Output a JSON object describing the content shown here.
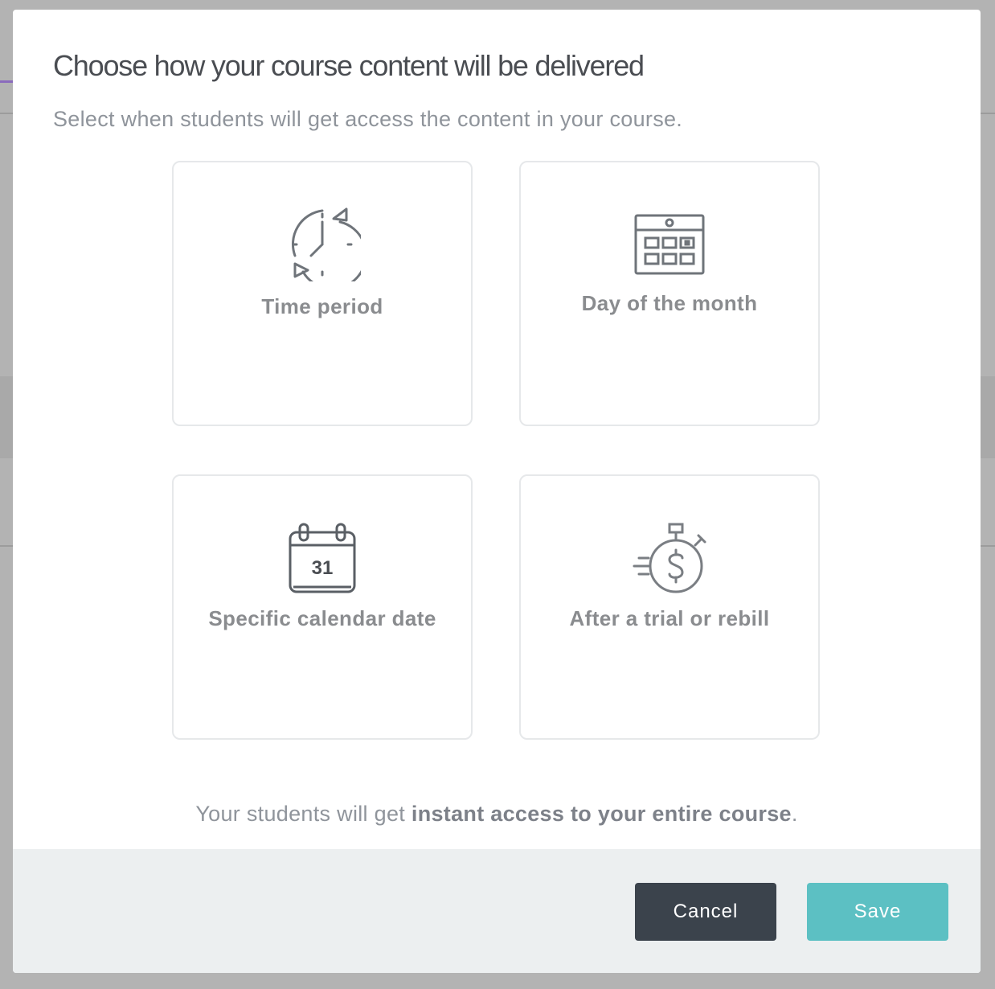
{
  "modal": {
    "title": "Choose how your course content will be delivered",
    "subtitle": "Select when students will get access the content in your course."
  },
  "options": [
    {
      "label": "Time period",
      "icon": "clock-cycle-icon"
    },
    {
      "label": "Day of the month",
      "icon": "calendar-grid-icon"
    },
    {
      "label": "Specific calendar date",
      "icon": "calendar-date-icon",
      "icon_text": "31"
    },
    {
      "label": "After a trial or rebill",
      "icon": "stopwatch-dollar-icon"
    }
  ],
  "info": {
    "prefix": "Your students will get ",
    "emphasis": "instant access to your entire course",
    "suffix": "."
  },
  "footer": {
    "cancel_label": "Cancel",
    "save_label": "Save",
    "save_color": "#5cc0c3",
    "cancel_color": "#3b434c"
  }
}
